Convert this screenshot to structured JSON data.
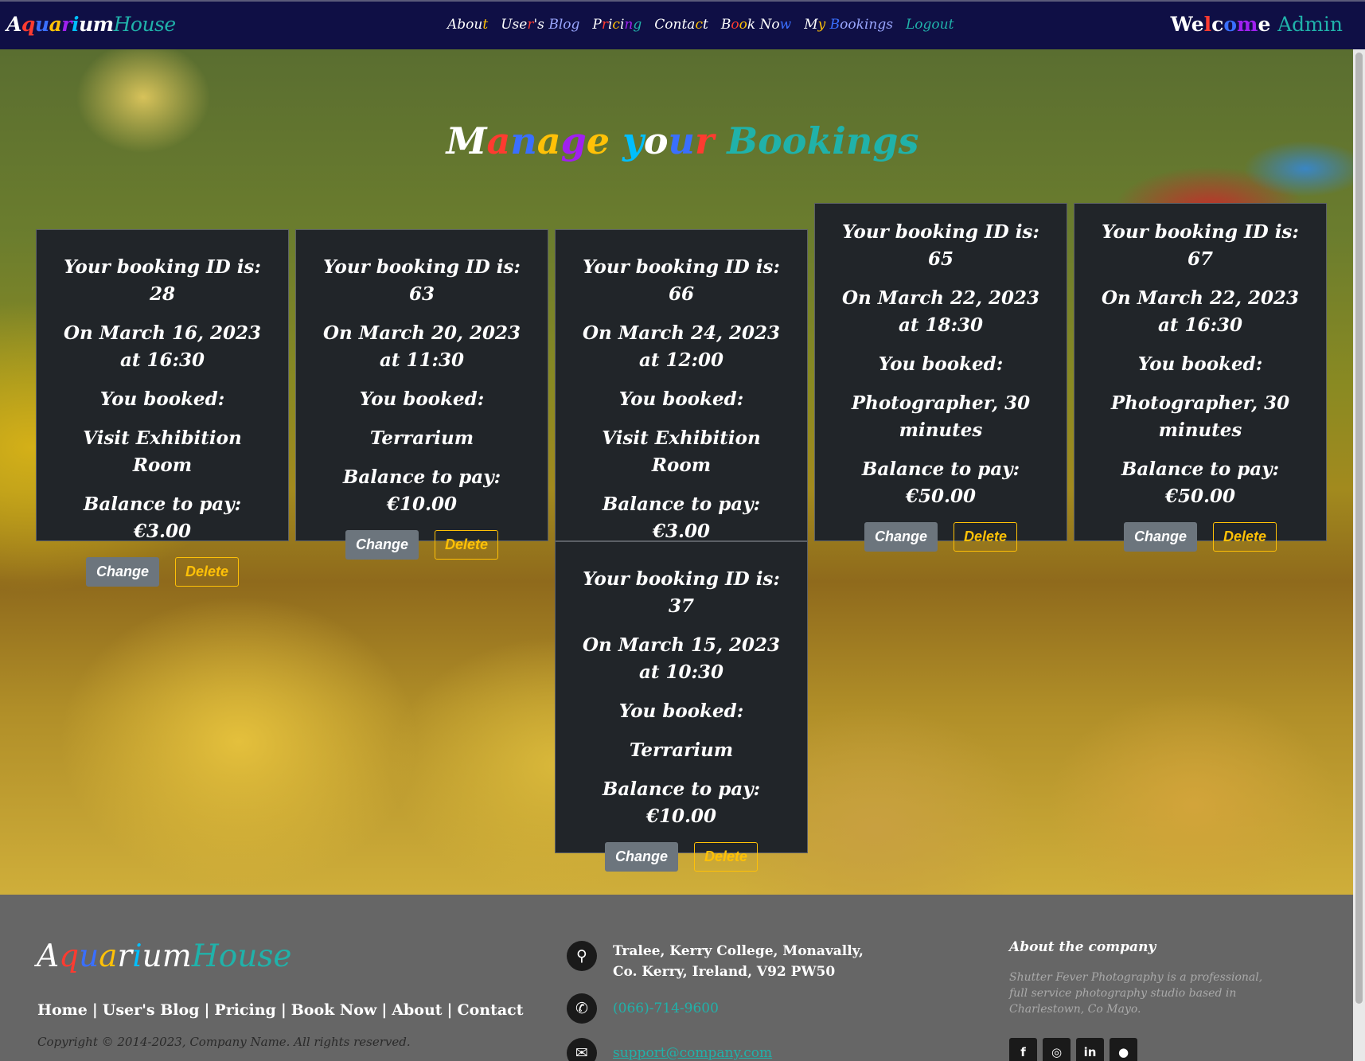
{
  "navbar": {
    "brand": {
      "letters": [
        {
          "ch": "A",
          "color": "#ffffff"
        },
        {
          "ch": "q",
          "color": "#ff3b30"
        },
        {
          "ch": "u",
          "color": "#3a6fff"
        },
        {
          "ch": "a",
          "color": "#ffc107"
        },
        {
          "ch": "r",
          "color": "#a020f0"
        },
        {
          "ch": "i",
          "color": "#00bfff"
        },
        {
          "ch": "u",
          "color": "#ffffff"
        },
        {
          "ch": "m",
          "color": "#ffffff"
        }
      ],
      "house": "House"
    },
    "links": [
      {
        "label": "About",
        "colors": [
          "#ffffff",
          "#ffffff",
          "#ffffff",
          "#ffffff",
          "#ffc107"
        ],
        "active": false
      },
      {
        "label": "User's Blog",
        "colors": [
          "#ffffff",
          "#ffffff",
          "#ffffff",
          "#ff3b30",
          "#ffffff",
          "#ffffff",
          "#3a6fff",
          "#9aa7ff",
          "#9aa7ff",
          "#9aa7ff",
          "#9aa7ff"
        ],
        "active": false
      },
      {
        "label": "Pricing",
        "colors": [
          "#ffffff",
          "#ff3b30",
          "#ffffff",
          "#ffc107",
          "#ffffff",
          "#a020f0",
          "#20b2aa"
        ],
        "active": false
      },
      {
        "label": "Contact",
        "colors": [
          "#ffffff",
          "#ffffff",
          "#ffffff",
          "#ffffff",
          "#ffffff",
          "#ffc107",
          "#ffffff"
        ],
        "active": false
      },
      {
        "label": "Book Now",
        "colors": [
          "#ffffff",
          "#ff3b30",
          "#ffc107",
          "#ffffff",
          "#ffffff",
          "#ffffff",
          "#ffffff",
          "#3a6fff"
        ],
        "active": false
      },
      {
        "label": "My Bookings",
        "colors": [
          "#ffffff",
          "#ffc107",
          "#ffffff",
          "#3a6fff",
          "#9aa7ff",
          "#9aa7ff",
          "#9aa7ff",
          "#9aa7ff",
          "#9aa7ff",
          "#9aa7ff",
          "#9aa7ff"
        ],
        "active": true
      },
      {
        "label": "Logout",
        "colors": [
          "#20b2aa",
          "#20b2aa",
          "#20b2aa",
          "#20b2aa",
          "#20b2aa",
          "#20b2aa"
        ],
        "active": false
      }
    ],
    "welcome": "Welcome",
    "welcome_colors": [
      "#ffffff",
      "#ffffff",
      "#ff3b30",
      "#ffffff",
      "#3a6fff",
      "#a020f0",
      "#ffffff"
    ],
    "user": "Admin"
  },
  "page": {
    "title_letters": [
      {
        "ch": "M",
        "color": "#ffffff"
      },
      {
        "ch": "a",
        "color": "#ff3b30"
      },
      {
        "ch": "n",
        "color": "#3a6fff"
      },
      {
        "ch": "a",
        "color": "#ffc107"
      },
      {
        "ch": "g",
        "color": "#a020f0"
      },
      {
        "ch": "e",
        "color": "#ffc107"
      },
      {
        "ch": " ",
        "color": "#ffffff"
      },
      {
        "ch": "y",
        "color": "#00bfff"
      },
      {
        "ch": "o",
        "color": "#ffffff"
      },
      {
        "ch": "u",
        "color": "#3a6fff"
      },
      {
        "ch": "r",
        "color": "#ff3b30"
      },
      {
        "ch": " ",
        "color": "#ffffff"
      },
      {
        "ch": "B",
        "color": "#20b2aa"
      },
      {
        "ch": "o",
        "color": "#20b2aa"
      },
      {
        "ch": "o",
        "color": "#20b2aa"
      },
      {
        "ch": "k",
        "color": "#20b2aa"
      },
      {
        "ch": "i",
        "color": "#20b2aa"
      },
      {
        "ch": "n",
        "color": "#20b2aa"
      },
      {
        "ch": "g",
        "color": "#20b2aa"
      },
      {
        "ch": "s",
        "color": "#20b2aa"
      }
    ]
  },
  "bookings": [
    {
      "id_text": "Your booking ID is: 28",
      "date_text": "On March 16, 2023 at 16:30",
      "booked_label": "You booked:",
      "service": "Visit Exhibition Room",
      "balance": "Balance to pay: €3.00",
      "change_label": "Change",
      "delete_label": "Delete"
    },
    {
      "id_text": "Your booking ID is: 63",
      "date_text": "On March 20, 2023 at 11:30",
      "booked_label": "You booked:",
      "service": "Terrarium",
      "balance": "Balance to pay: €10.00",
      "change_label": "Change",
      "delete_label": "Delete"
    },
    {
      "id_text": "Your booking ID is: 66",
      "date_text": "On March 24, 2023 at 12:00",
      "booked_label": "You booked:",
      "service": "Visit Exhibition Room",
      "balance": "Balance to pay: €3.00",
      "change_label": "Change",
      "delete_label": "Delete"
    },
    {
      "id_text": "Your booking ID is: 65",
      "date_text": "On March 22, 2023 at 18:30",
      "booked_label": "You booked:",
      "service": "Photographer, 30 minutes",
      "balance": "Balance to pay: €50.00",
      "change_label": "Change",
      "delete_label": "Delete"
    },
    {
      "id_text": "Your booking ID is: 67",
      "date_text": "On March 22, 2023 at 16:30",
      "booked_label": "You booked:",
      "service": "Photographer, 30 minutes",
      "balance": "Balance to pay: €50.00",
      "change_label": "Change",
      "delete_label": "Delete"
    },
    {
      "id_text": "Your booking ID is: 37",
      "date_text": "On March 15, 2023 at 10:30",
      "booked_label": "You booked:",
      "service": "Terrarium",
      "balance": "Balance to pay: €10.00",
      "change_label": "Change",
      "delete_label": "Delete"
    }
  ],
  "footer": {
    "brand_letters": [
      {
        "ch": "A",
        "color": "#ffffff"
      },
      {
        "ch": "q",
        "color": "#ff3b30"
      },
      {
        "ch": "u",
        "color": "#3a6fff"
      },
      {
        "ch": "a",
        "color": "#ffc107"
      },
      {
        "ch": "r",
        "color": "#ffffff"
      },
      {
        "ch": "i",
        "color": "#00bfff"
      },
      {
        "ch": "u",
        "color": "#ffffff"
      },
      {
        "ch": "m",
        "color": "#ffffff"
      }
    ],
    "brand_house": "House",
    "links": [
      "Home",
      "User's Blog",
      "Pricing",
      "Book Now",
      "About",
      "Contact"
    ],
    "copyright": "Copyright © 2014-2023, Company Name. All rights reserved.",
    "address_line1": "Tralee, Kerry College, Monavally,",
    "address_line2": "Co. Kerry, Ireland, V92 PW50",
    "phone": "(066)-714-9600",
    "email": "support@company.com",
    "about_title": "About the company",
    "about_text": "Shutter Fever Photography is a professional, full service photography studio based in Charlestown, Co Mayo.",
    "socials": [
      {
        "icon": "facebook-icon",
        "glyph": "f"
      },
      {
        "icon": "instagram-icon",
        "glyph": "◎"
      },
      {
        "icon": "linkedin-icon",
        "glyph": "in"
      },
      {
        "icon": "github-icon",
        "glyph": "●"
      }
    ],
    "icons": {
      "location": "⚲",
      "phone": "✆",
      "email": "✉"
    }
  }
}
